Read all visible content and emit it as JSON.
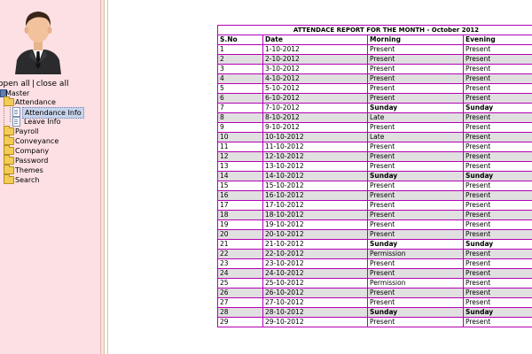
{
  "tree": {
    "open_all": "open all",
    "separator": "|",
    "close_all": "close all",
    "items": [
      {
        "label": "Master",
        "icon": "tree-root-icon"
      },
      {
        "label": "Attendance",
        "icon": "folder-open-icon"
      },
      {
        "label": "Attendance Info",
        "icon": "page-icon",
        "selected": true
      },
      {
        "label": "Leave Info",
        "icon": "page-icon"
      },
      {
        "label": "Payroll",
        "icon": "folder-icon"
      },
      {
        "label": "Conveyance",
        "icon": "folder-icon"
      },
      {
        "label": "Company",
        "icon": "folder-icon"
      },
      {
        "label": "Password",
        "icon": "folder-icon"
      },
      {
        "label": "Themes",
        "icon": "folder-icon"
      },
      {
        "label": "Search",
        "icon": "folder-icon"
      }
    ]
  },
  "report": {
    "title": "ATTENDACE REPORT FOR THE MONTH - October 2012",
    "headers": [
      "S.No",
      "Date",
      "Morning",
      "Evening"
    ],
    "rows": [
      [
        "1",
        "1-10-2012",
        "Present",
        "Present"
      ],
      [
        "2",
        "2-10-2012",
        "Present",
        "Present"
      ],
      [
        "3",
        "3-10-2012",
        "Present",
        "Present"
      ],
      [
        "4",
        "4-10-2012",
        "Present",
        "Present"
      ],
      [
        "5",
        "5-10-2012",
        "Present",
        "Present"
      ],
      [
        "6",
        "6-10-2012",
        "Present",
        "Present"
      ],
      [
        "7",
        "7-10-2012",
        "Sunday",
        "Sunday"
      ],
      [
        "8",
        "8-10-2012",
        "Late",
        "Present"
      ],
      [
        "9",
        "9-10-2012",
        "Present",
        "Present"
      ],
      [
        "10",
        "10-10-2012",
        "Late",
        "Present"
      ],
      [
        "11",
        "11-10-2012",
        "Present",
        "Present"
      ],
      [
        "12",
        "12-10-2012",
        "Present",
        "Present"
      ],
      [
        "13",
        "13-10-2012",
        "Present",
        "Present"
      ],
      [
        "14",
        "14-10-2012",
        "Sunday",
        "Sunday"
      ],
      [
        "15",
        "15-10-2012",
        "Present",
        "Present"
      ],
      [
        "16",
        "16-10-2012",
        "Present",
        "Present"
      ],
      [
        "17",
        "17-10-2012",
        "Present",
        "Present"
      ],
      [
        "18",
        "18-10-2012",
        "Present",
        "Present"
      ],
      [
        "19",
        "19-10-2012",
        "Present",
        "Present"
      ],
      [
        "20",
        "20-10-2012",
        "Present",
        "Present"
      ],
      [
        "21",
        "21-10-2012",
        "Sunday",
        "Sunday"
      ],
      [
        "22",
        "22-10-2012",
        "Permission",
        "Present"
      ],
      [
        "23",
        "23-10-2012",
        "Present",
        "Present"
      ],
      [
        "24",
        "24-10-2012",
        "Present",
        "Present"
      ],
      [
        "25",
        "25-10-2012",
        "Permission",
        "Present"
      ],
      [
        "26",
        "26-10-2012",
        "Present",
        "Present"
      ],
      [
        "27",
        "27-10-2012",
        "Present",
        "Present"
      ],
      [
        "28",
        "28-10-2012",
        "Sunday",
        "Sunday"
      ],
      [
        "29",
        "29-10-2012",
        "Present",
        "Present"
      ]
    ]
  },
  "colors": {
    "sidebar_bg": "#fde0e4",
    "table_border": "#b400b4",
    "row_shade": "#e0e0e0",
    "selected_bg": "#c8d4ec"
  }
}
